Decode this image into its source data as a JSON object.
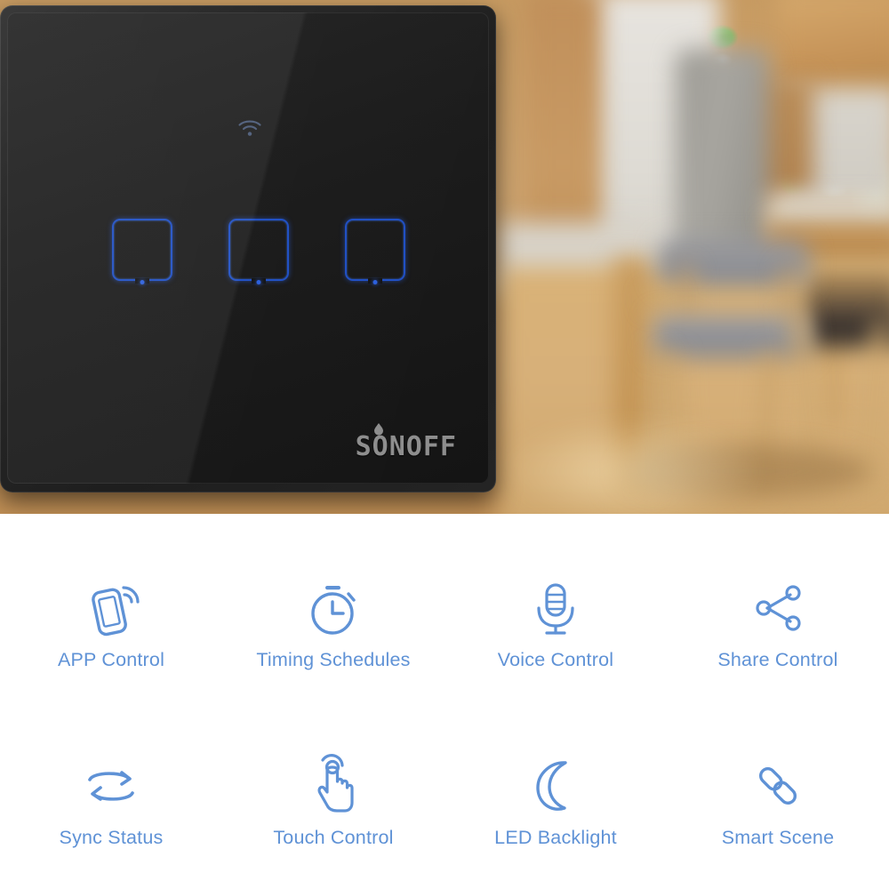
{
  "product": {
    "brand_wordmark": "SONOFF",
    "panel": {
      "type": "3-gang touch wall switch",
      "finish_color": "#1b1b1b",
      "accent_color": "#2b5fdd",
      "wifi_indicator_icon": "wifi-icon",
      "keys": [
        {
          "id": "gang-1",
          "label": "",
          "state": "off"
        },
        {
          "id": "gang-2",
          "label": "",
          "state": "off"
        },
        {
          "id": "gang-3",
          "label": "",
          "state": "off"
        }
      ]
    },
    "scene_photo": {
      "description": "Blurred warm kitchen and dining room interior",
      "wall_color": "#d8d3c9",
      "floor_color": "#d7b079",
      "wood_color": "#c49458"
    }
  },
  "features": {
    "text_color": "#5f92d6",
    "items": [
      {
        "label": "APP Control",
        "icon": "phone-signal-icon"
      },
      {
        "label": "Timing Schedules",
        "icon": "stopwatch-icon"
      },
      {
        "label": "Voice Control",
        "icon": "microphone-icon"
      },
      {
        "label": "Share Control",
        "icon": "share-nodes-icon"
      },
      {
        "label": "Sync Status",
        "icon": "sync-arrows-icon"
      },
      {
        "label": "Touch Control",
        "icon": "hand-tap-icon"
      },
      {
        "label": "LED Backlight",
        "icon": "crescent-moon-icon"
      },
      {
        "label": "Smart Scene",
        "icon": "chain-link-icon"
      }
    ]
  }
}
